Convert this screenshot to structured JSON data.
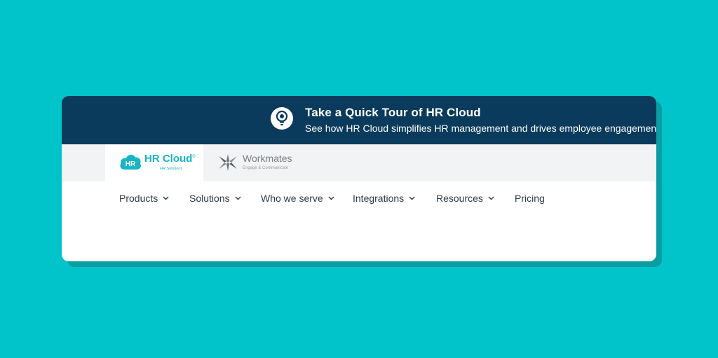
{
  "banner": {
    "title": "Take a Quick Tour of HR Cloud",
    "subtitle": "See how HR Cloud simplifies HR management and drives employee engagement.",
    "icon": "lightbulb-icon",
    "background_color": "#0b3b5c"
  },
  "brands": {
    "hr_cloud": {
      "badge": "HR",
      "name": "HR Cloud",
      "mark": "®",
      "tagline": "HR Solutions",
      "color": "#17b6c4"
    },
    "workmates": {
      "name": "Workmates",
      "tagline": "Engage & Communicate",
      "color": "#7a7e82"
    }
  },
  "nav": {
    "items": [
      {
        "label": "Products",
        "has_dropdown": true
      },
      {
        "label": "Solutions",
        "has_dropdown": true
      },
      {
        "label": "Who we serve",
        "has_dropdown": true
      },
      {
        "label": "Integrations",
        "has_dropdown": true
      },
      {
        "label": "Resources",
        "has_dropdown": true
      },
      {
        "label": "Pricing",
        "has_dropdown": false
      }
    ]
  },
  "colors": {
    "page_background": "#00c4c9",
    "card_background": "#ffffff",
    "nav_text": "#2d3b45"
  }
}
